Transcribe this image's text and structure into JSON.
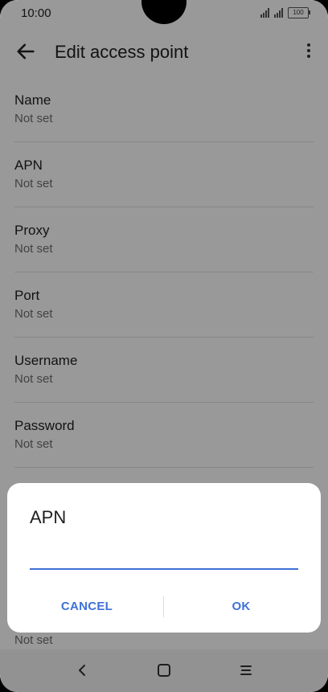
{
  "status_bar": {
    "time": "10:00",
    "battery_level": "100"
  },
  "app_bar": {
    "title": "Edit access point",
    "back_icon": "arrow-left-icon",
    "more_icon": "more-vert-icon"
  },
  "settings": [
    {
      "label": "Name",
      "value": "Not set"
    },
    {
      "label": "APN",
      "value": "Not set"
    },
    {
      "label": "Proxy",
      "value": "Not set"
    },
    {
      "label": "Port",
      "value": "Not set"
    },
    {
      "label": "Username",
      "value": "Not set"
    },
    {
      "label": "Password",
      "value": "Not set"
    }
  ],
  "partial_item_value": "Not set",
  "dialog": {
    "title": "APN",
    "input_value": "",
    "cancel_label": "CANCEL",
    "ok_label": "OK"
  },
  "nav_bar": {
    "back_icon": "nav-back-icon",
    "home_icon": "nav-home-icon",
    "menu_icon": "nav-menu-icon"
  },
  "colors": {
    "accent": "#3f71d8",
    "scrim": "rgba(0,0,0,0.4)"
  }
}
